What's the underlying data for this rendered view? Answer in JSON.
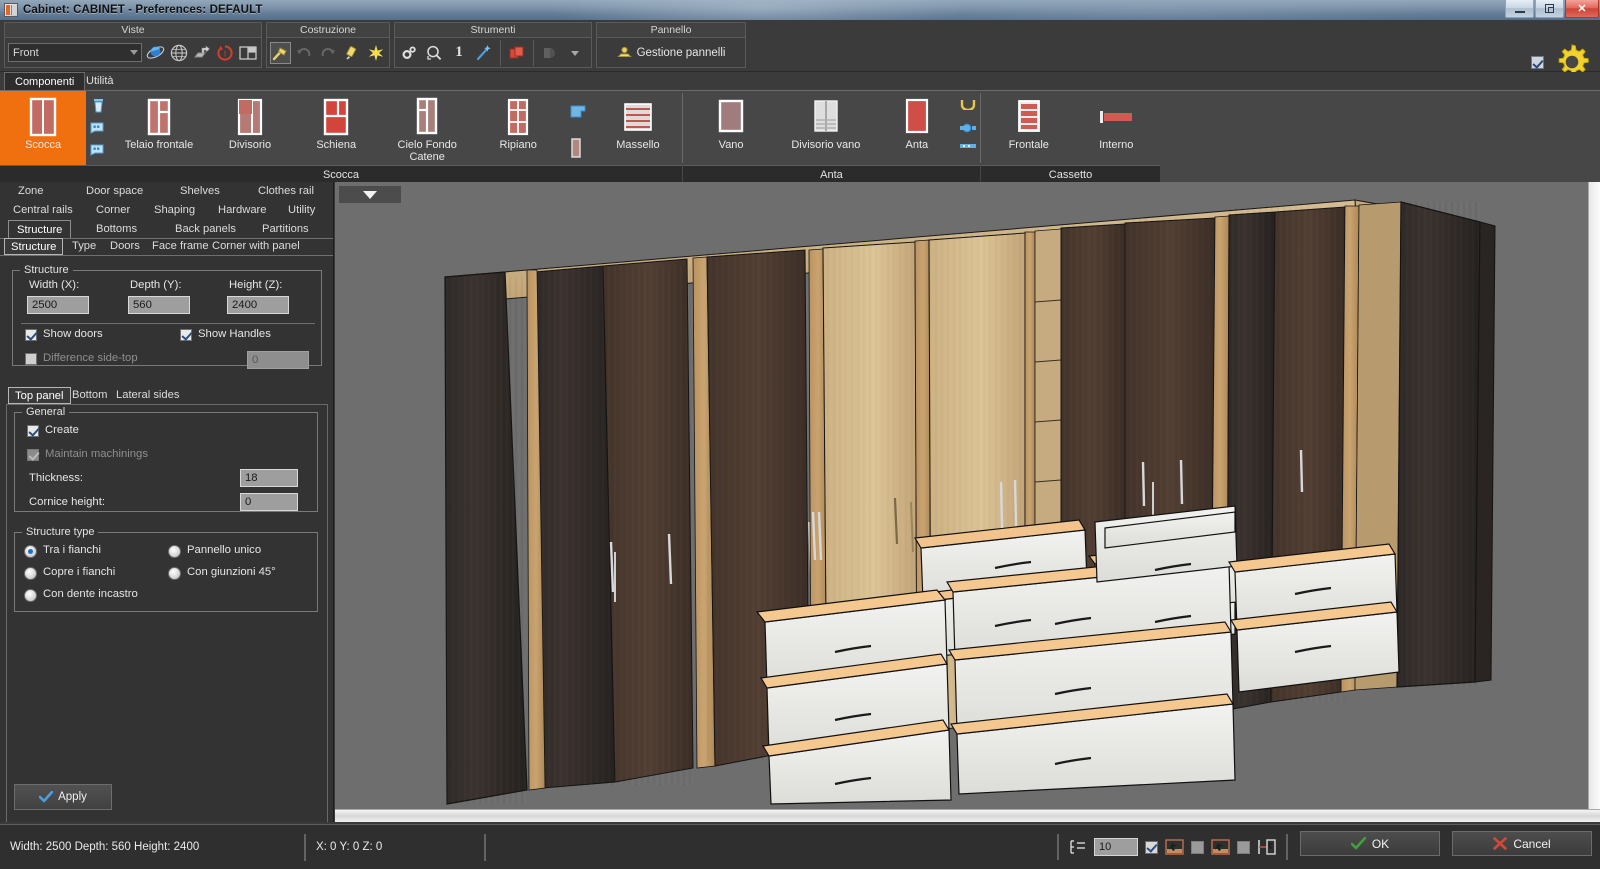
{
  "window": {
    "title": "Cabinet: CABINET - Preferences: DEFAULT",
    "minimize": "minimize",
    "restore": "restore",
    "close": "✕"
  },
  "toolbar": {
    "groups": [
      {
        "title": "Viste",
        "combo_value": "Front",
        "buttons": [
          "globe-blue-icon",
          "globe-wire-icon",
          "export-view-icon",
          "reset-view-icon",
          "split-view-icon"
        ]
      },
      {
        "title": "Costruzione",
        "buttons": [
          "hammer-icon",
          "undo-icon",
          "redo-icon",
          "eraser-icon",
          "sparkle-icon"
        ]
      },
      {
        "title": "Strumenti",
        "buttons": [
          "settings-gears-icon",
          "zoom-search-icon",
          "one-icon",
          "magic-wand-icon",
          "copy-red-icon",
          "render-icon",
          "dropdown-arrow-icon"
        ]
      },
      {
        "title": "Pannello",
        "panel_button": "Gestione pannelli"
      }
    ]
  },
  "component_tabs": [
    {
      "label": "Componenti",
      "selected": true
    },
    {
      "label": "Utilità",
      "selected": false
    }
  ],
  "ribbon": {
    "groups": [
      {
        "label": "Scocca",
        "items": [
          {
            "label": "Scocca",
            "icon": "cabinet-body-icon",
            "selected": true
          },
          {
            "label": "Telaio frontale",
            "icon": "front-frame-icon",
            "selected": false
          },
          {
            "label": "Divisorio",
            "icon": "divider-icon",
            "selected": false
          },
          {
            "label": "Schiena",
            "icon": "back-panel-icon",
            "selected": false
          },
          {
            "label": "Cielo Fondo Catene",
            "icon": "top-bottom-icon",
            "selected": false
          },
          {
            "label": "Ripiano",
            "icon": "shelf-icon",
            "selected": false
          },
          {
            "label": "Massello",
            "icon": "solid-wood-icon",
            "selected": false
          }
        ],
        "mini_icons": [
          "trash-icon",
          "tag-icon",
          "tag-alt-icon"
        ]
      },
      {
        "label": "Anta",
        "items": [
          {
            "label": "Vano",
            "icon": "compartment-icon",
            "selected": false
          },
          {
            "label": "Divisorio vano",
            "icon": "compartment-divider-icon",
            "selected": false
          },
          {
            "label": "Anta",
            "icon": "door-icon",
            "selected": false
          }
        ],
        "mini_icons": [
          "handle-icon",
          "hinge-icon",
          "rail-icon"
        ]
      },
      {
        "label": "Cassetto",
        "items": [
          {
            "label": "Frontale",
            "icon": "drawer-front-icon",
            "selected": false
          },
          {
            "label": "Interno",
            "icon": "drawer-inner-icon",
            "selected": false
          }
        ],
        "mini_icons": []
      }
    ]
  },
  "left_panel": {
    "nav_rows": [
      [
        "Zone",
        "Door space",
        "Shelves",
        "Clothes rail"
      ],
      [
        "Central rails",
        "Corner",
        "Shaping",
        "Hardware",
        "Utility"
      ],
      [
        "Structure",
        "Bottoms",
        "Back panels",
        "Partitions"
      ]
    ],
    "nav_selected": "Structure",
    "sub_tabs": [
      "Structure",
      "Type",
      "Doors",
      "Face frame",
      "Corner with panel"
    ],
    "sub_selected": "Structure",
    "structure_group": {
      "legend": "Structure",
      "width_label": "Width (X):",
      "width_value": "2500",
      "depth_label": "Depth (Y):",
      "depth_value": "560",
      "height_label": "Height (Z):",
      "height_value": "2400",
      "show_doors_label": "Show doors",
      "show_doors_checked": true,
      "show_handles_label": "Show Handles",
      "show_handles_checked": true,
      "difference_label": "Difference side-top",
      "difference_checked": false,
      "difference_value": "0"
    },
    "panel_tabs": [
      "Top panel",
      "Bottom",
      "Lateral sides"
    ],
    "panel_tab_selected": "Top panel",
    "general_group": {
      "legend": "General",
      "create_label": "Create",
      "create_checked": true,
      "maintain_label": "Maintain machinings",
      "maintain_checked": true,
      "thickness_label": "Thickness:",
      "thickness_value": "18",
      "cornice_label": "Cornice height:",
      "cornice_value": "0"
    },
    "structure_type_group": {
      "legend": "Structure type",
      "options": [
        {
          "label": "Tra i fianchi",
          "selected": true
        },
        {
          "label": "Pannello unico",
          "selected": false
        },
        {
          "label": "Copre i fianchi",
          "selected": false
        },
        {
          "label": "Con giunzioni 45°",
          "selected": false
        },
        {
          "label": "Con dente incastro",
          "selected": false
        }
      ]
    },
    "apply_label": "Apply"
  },
  "viewport": {
    "dropdown": "view-menu-arrow-icon"
  },
  "statusbar": {
    "dimensions": "Width: 2500  Depth: 560  Height: 2400",
    "coordinates": "X: 0   Y: 0   Z: 0",
    "step_value": "10",
    "toggles": [
      {
        "name": "snap-list-icon",
        "checked": null
      },
      {
        "name": "toggle-a",
        "checked": true
      },
      {
        "name": "toggle-b",
        "checked": false
      },
      {
        "name": "toggle-c",
        "checked": false
      }
    ],
    "ok_label": "OK",
    "cancel_label": "Cancel"
  },
  "colors": {
    "accent_orange": "#f07010",
    "panel_bg": "#333333",
    "ribbon_bg": "#474747",
    "viewport_bg": "#6e6e6e",
    "ok_green": "#3fa03f",
    "cancel_red": "#d04a3a"
  }
}
